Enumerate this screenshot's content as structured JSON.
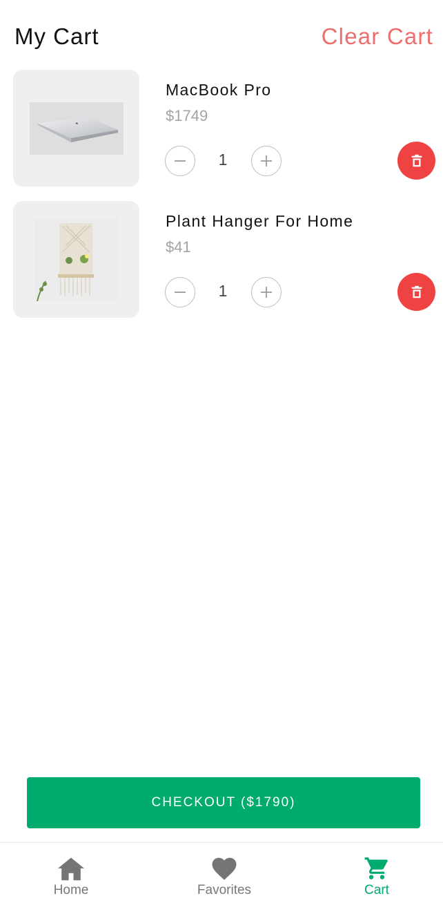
{
  "header": {
    "title": "My Cart",
    "clear_label": "Clear Cart"
  },
  "items": [
    {
      "name": "MacBook Pro",
      "price": "$1749",
      "quantity": "1",
      "image": "laptop-image"
    },
    {
      "name": "Plant Hanger For Home",
      "price": "$41",
      "quantity": "1",
      "image": "macrame-plant-hanger-image"
    }
  ],
  "checkout": {
    "label": "CHECKOUT ($1790)"
  },
  "nav": {
    "items": [
      {
        "label": "Home",
        "icon": "home-icon"
      },
      {
        "label": "Favorites",
        "icon": "heart-icon"
      },
      {
        "label": "Cart",
        "icon": "cart-icon"
      }
    ],
    "active": "Cart"
  },
  "colors": {
    "accent": "#00ab6e",
    "clear": "#ef6d6d",
    "delete": "#ef4343"
  }
}
